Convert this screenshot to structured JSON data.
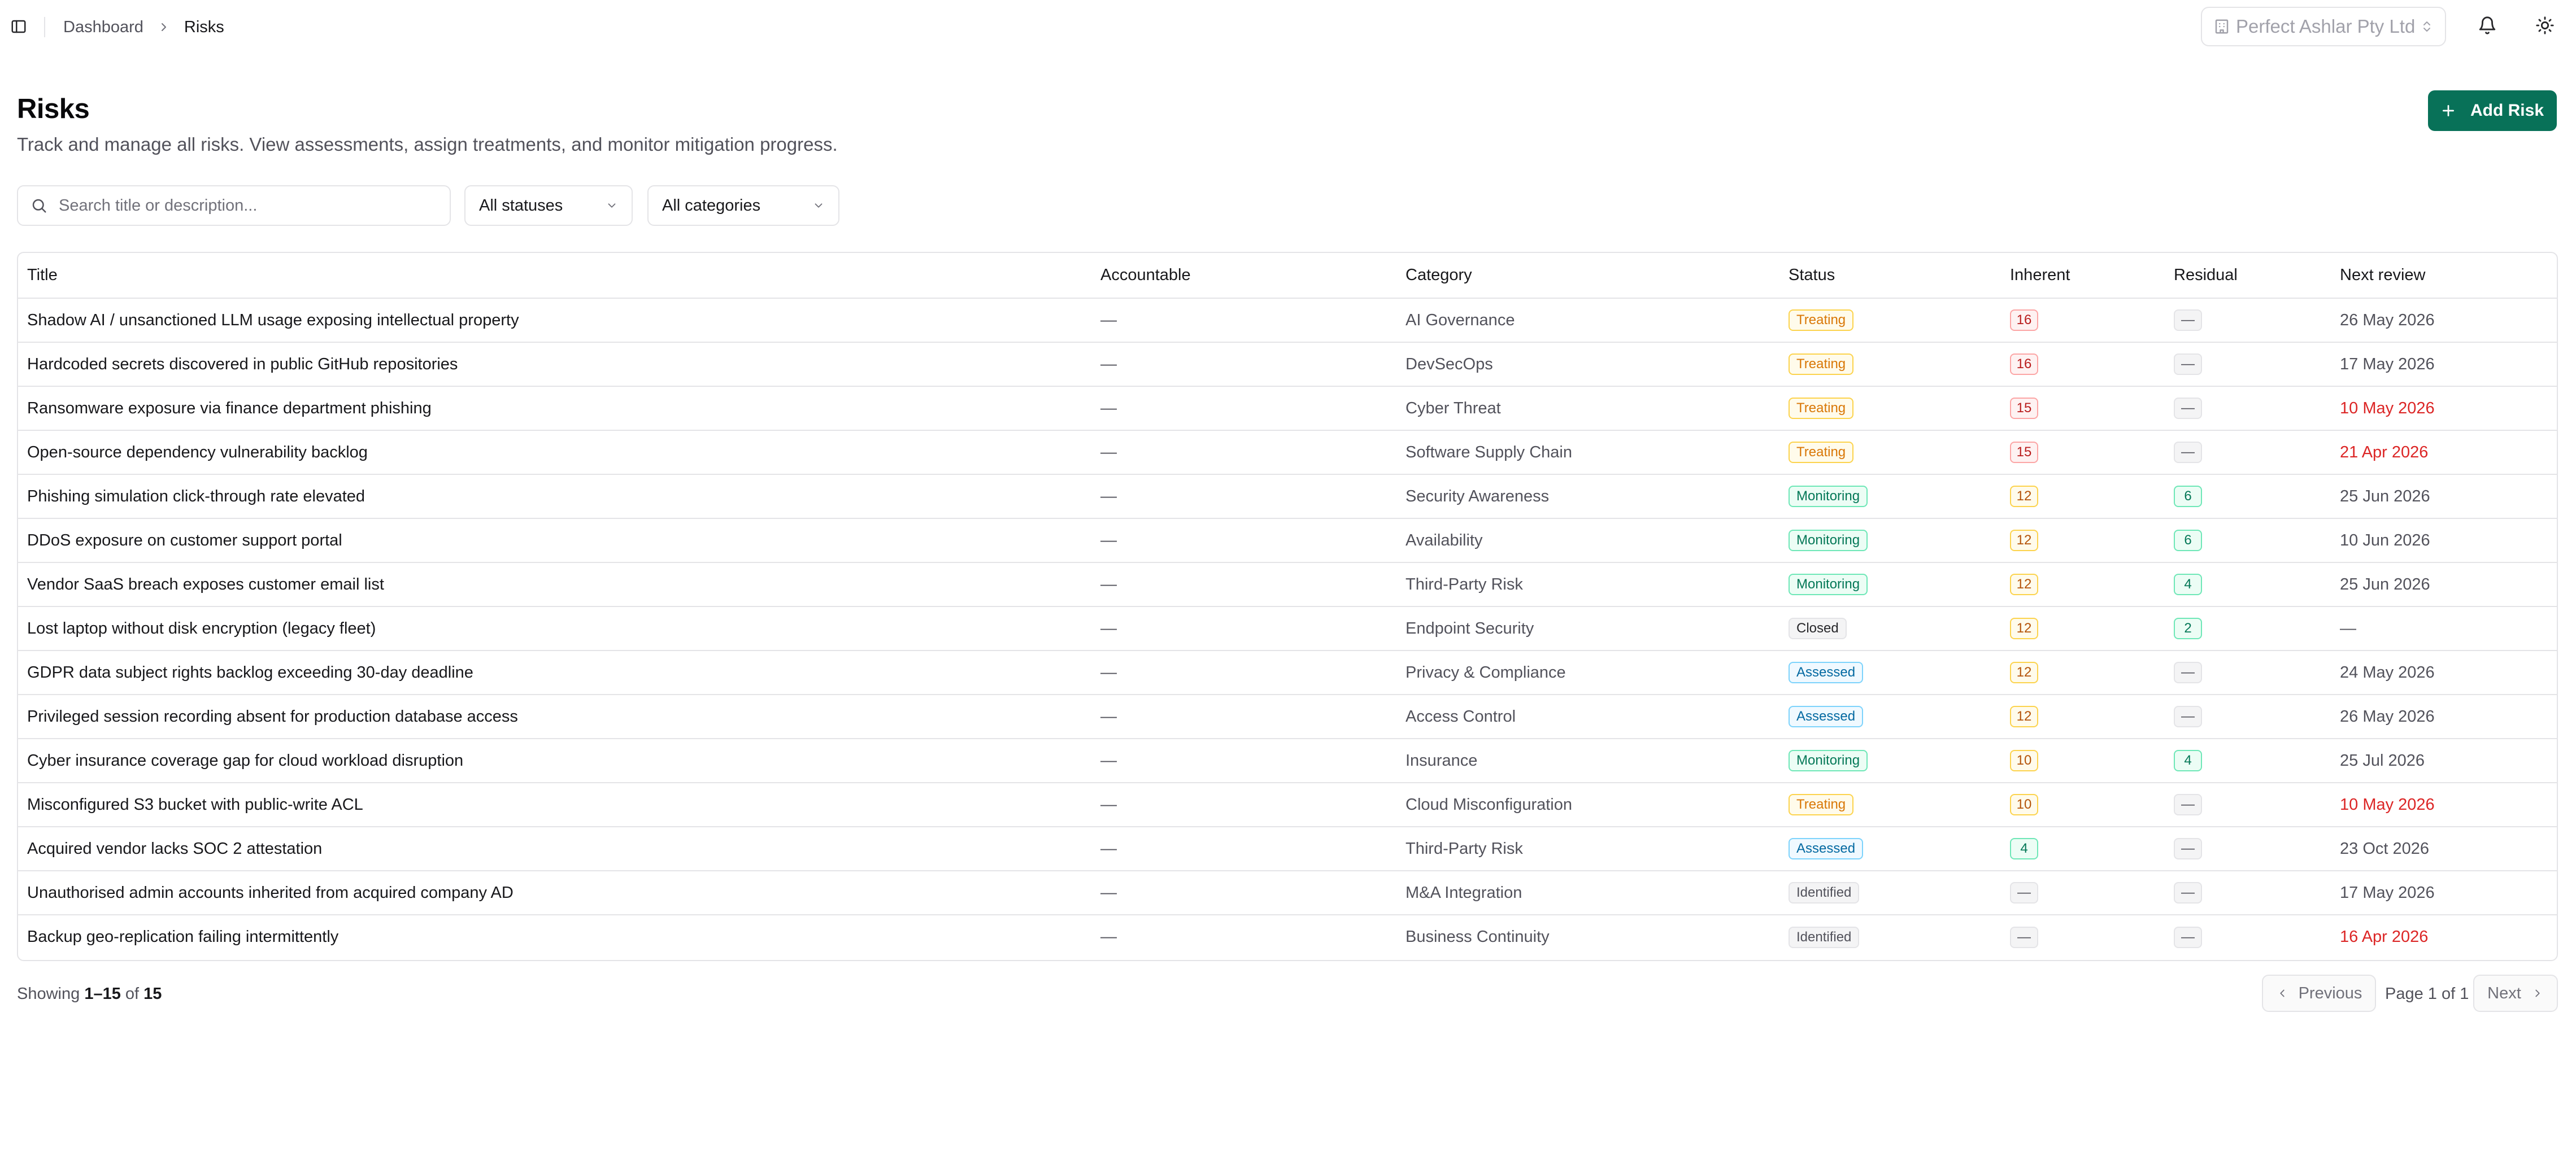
{
  "topbar": {
    "sidebar_toggle_icon": "sidebar-panel-icon",
    "breadcrumb": {
      "parent": "Dashboard",
      "current": "Risks"
    },
    "org_selector": {
      "value": "Perfect Ashlar Pty Ltd",
      "icon": "building-icon"
    },
    "icons": {
      "notifications": "bell-icon",
      "theme": "sun-icon"
    }
  },
  "header": {
    "title": "Risks",
    "subtitle": "Track and manage all risks. View assessments, assign treatments, and monitor mitigation progress.",
    "add_button": "Add Risk"
  },
  "filters": {
    "search_placeholder": "Search title or description...",
    "status": "All statuses",
    "category": "All categories"
  },
  "table": {
    "columns": [
      "Title",
      "Accountable",
      "Category",
      "Status",
      "Inherent",
      "Residual",
      "Next review"
    ],
    "rows": [
      {
        "title": "Shadow AI / unsanctioned LLM usage exposing intellectual property",
        "accountable": "—",
        "category": "AI Governance",
        "status": "Treating",
        "inherent": "16",
        "inherent_level": "red",
        "residual": "—",
        "residual_level": "none",
        "next_review": "26 May 2026",
        "overdue": false
      },
      {
        "title": "Hardcoded secrets discovered in public GitHub repositories",
        "accountable": "—",
        "category": "DevSecOps",
        "status": "Treating",
        "inherent": "16",
        "inherent_level": "red",
        "residual": "—",
        "residual_level": "none",
        "next_review": "17 May 2026",
        "overdue": false
      },
      {
        "title": "Ransomware exposure via finance department phishing",
        "accountable": "—",
        "category": "Cyber Threat",
        "status": "Treating",
        "inherent": "15",
        "inherent_level": "red",
        "residual": "—",
        "residual_level": "none",
        "next_review": "10 May 2026",
        "overdue": true
      },
      {
        "title": "Open-source dependency vulnerability backlog",
        "accountable": "—",
        "category": "Software Supply Chain",
        "status": "Treating",
        "inherent": "15",
        "inherent_level": "red",
        "residual": "—",
        "residual_level": "none",
        "next_review": "21 Apr 2026",
        "overdue": true
      },
      {
        "title": "Phishing simulation click-through rate elevated",
        "accountable": "—",
        "category": "Security Awareness",
        "status": "Monitoring",
        "inherent": "12",
        "inherent_level": "amber",
        "residual": "6",
        "residual_level": "green",
        "next_review": "25 Jun 2026",
        "overdue": false
      },
      {
        "title": "DDoS exposure on customer support portal",
        "accountable": "—",
        "category": "Availability",
        "status": "Monitoring",
        "inherent": "12",
        "inherent_level": "amber",
        "residual": "6",
        "residual_level": "green",
        "next_review": "10 Jun 2026",
        "overdue": false
      },
      {
        "title": "Vendor SaaS breach exposes customer email list",
        "accountable": "—",
        "category": "Third-Party Risk",
        "status": "Monitoring",
        "inherent": "12",
        "inherent_level": "amber",
        "residual": "4",
        "residual_level": "green",
        "next_review": "25 Jun 2026",
        "overdue": false
      },
      {
        "title": "Lost laptop without disk encryption (legacy fleet)",
        "accountable": "—",
        "category": "Endpoint Security",
        "status": "Closed",
        "inherent": "12",
        "inherent_level": "amber",
        "residual": "2",
        "residual_level": "green",
        "next_review": "—",
        "overdue": false
      },
      {
        "title": "GDPR data subject rights backlog exceeding 30-day deadline",
        "accountable": "—",
        "category": "Privacy & Compliance",
        "status": "Assessed",
        "inherent": "12",
        "inherent_level": "amber",
        "residual": "—",
        "residual_level": "none",
        "next_review": "24 May 2026",
        "overdue": false
      },
      {
        "title": "Privileged session recording absent for production database access",
        "accountable": "—",
        "category": "Access Control",
        "status": "Assessed",
        "inherent": "12",
        "inherent_level": "amber",
        "residual": "—",
        "residual_level": "none",
        "next_review": "26 May 2026",
        "overdue": false
      },
      {
        "title": "Cyber insurance coverage gap for cloud workload disruption",
        "accountable": "—",
        "category": "Insurance",
        "status": "Monitoring",
        "inherent": "10",
        "inherent_level": "amber",
        "residual": "4",
        "residual_level": "green",
        "next_review": "25 Jul 2026",
        "overdue": false
      },
      {
        "title": "Misconfigured S3 bucket with public-write ACL",
        "accountable": "—",
        "category": "Cloud Misconfiguration",
        "status": "Treating",
        "inherent": "10",
        "inherent_level": "amber",
        "residual": "—",
        "residual_level": "none",
        "next_review": "10 May 2026",
        "overdue": true
      },
      {
        "title": "Acquired vendor lacks SOC 2 attestation",
        "accountable": "—",
        "category": "Third-Party Risk",
        "status": "Assessed",
        "inherent": "4",
        "inherent_level": "green",
        "residual": "—",
        "residual_level": "none",
        "next_review": "23 Oct 2026",
        "overdue": false
      },
      {
        "title": "Unauthorised admin accounts inherited from acquired company AD",
        "accountable": "—",
        "category": "M&A Integration",
        "status": "Identified",
        "inherent": "—",
        "inherent_level": "none",
        "residual": "—",
        "residual_level": "none",
        "next_review": "17 May 2026",
        "overdue": false
      },
      {
        "title": "Backup geo-replication failing intermittently",
        "accountable": "—",
        "category": "Business Continuity",
        "status": "Identified",
        "inherent": "—",
        "inherent_level": "none",
        "residual": "—",
        "residual_level": "none",
        "next_review": "16 Apr 2026",
        "overdue": true
      }
    ]
  },
  "pagination": {
    "showing_prefix": "Showing",
    "range": "1–15",
    "of": "of",
    "total": "15",
    "previous": "Previous",
    "page_indicator": "Page 1 of 1",
    "next": "Next"
  },
  "colors": {
    "primary": "#087158",
    "overdue": "#dc2626",
    "border": "#e4e4e7",
    "muted_text": "#52525b"
  }
}
